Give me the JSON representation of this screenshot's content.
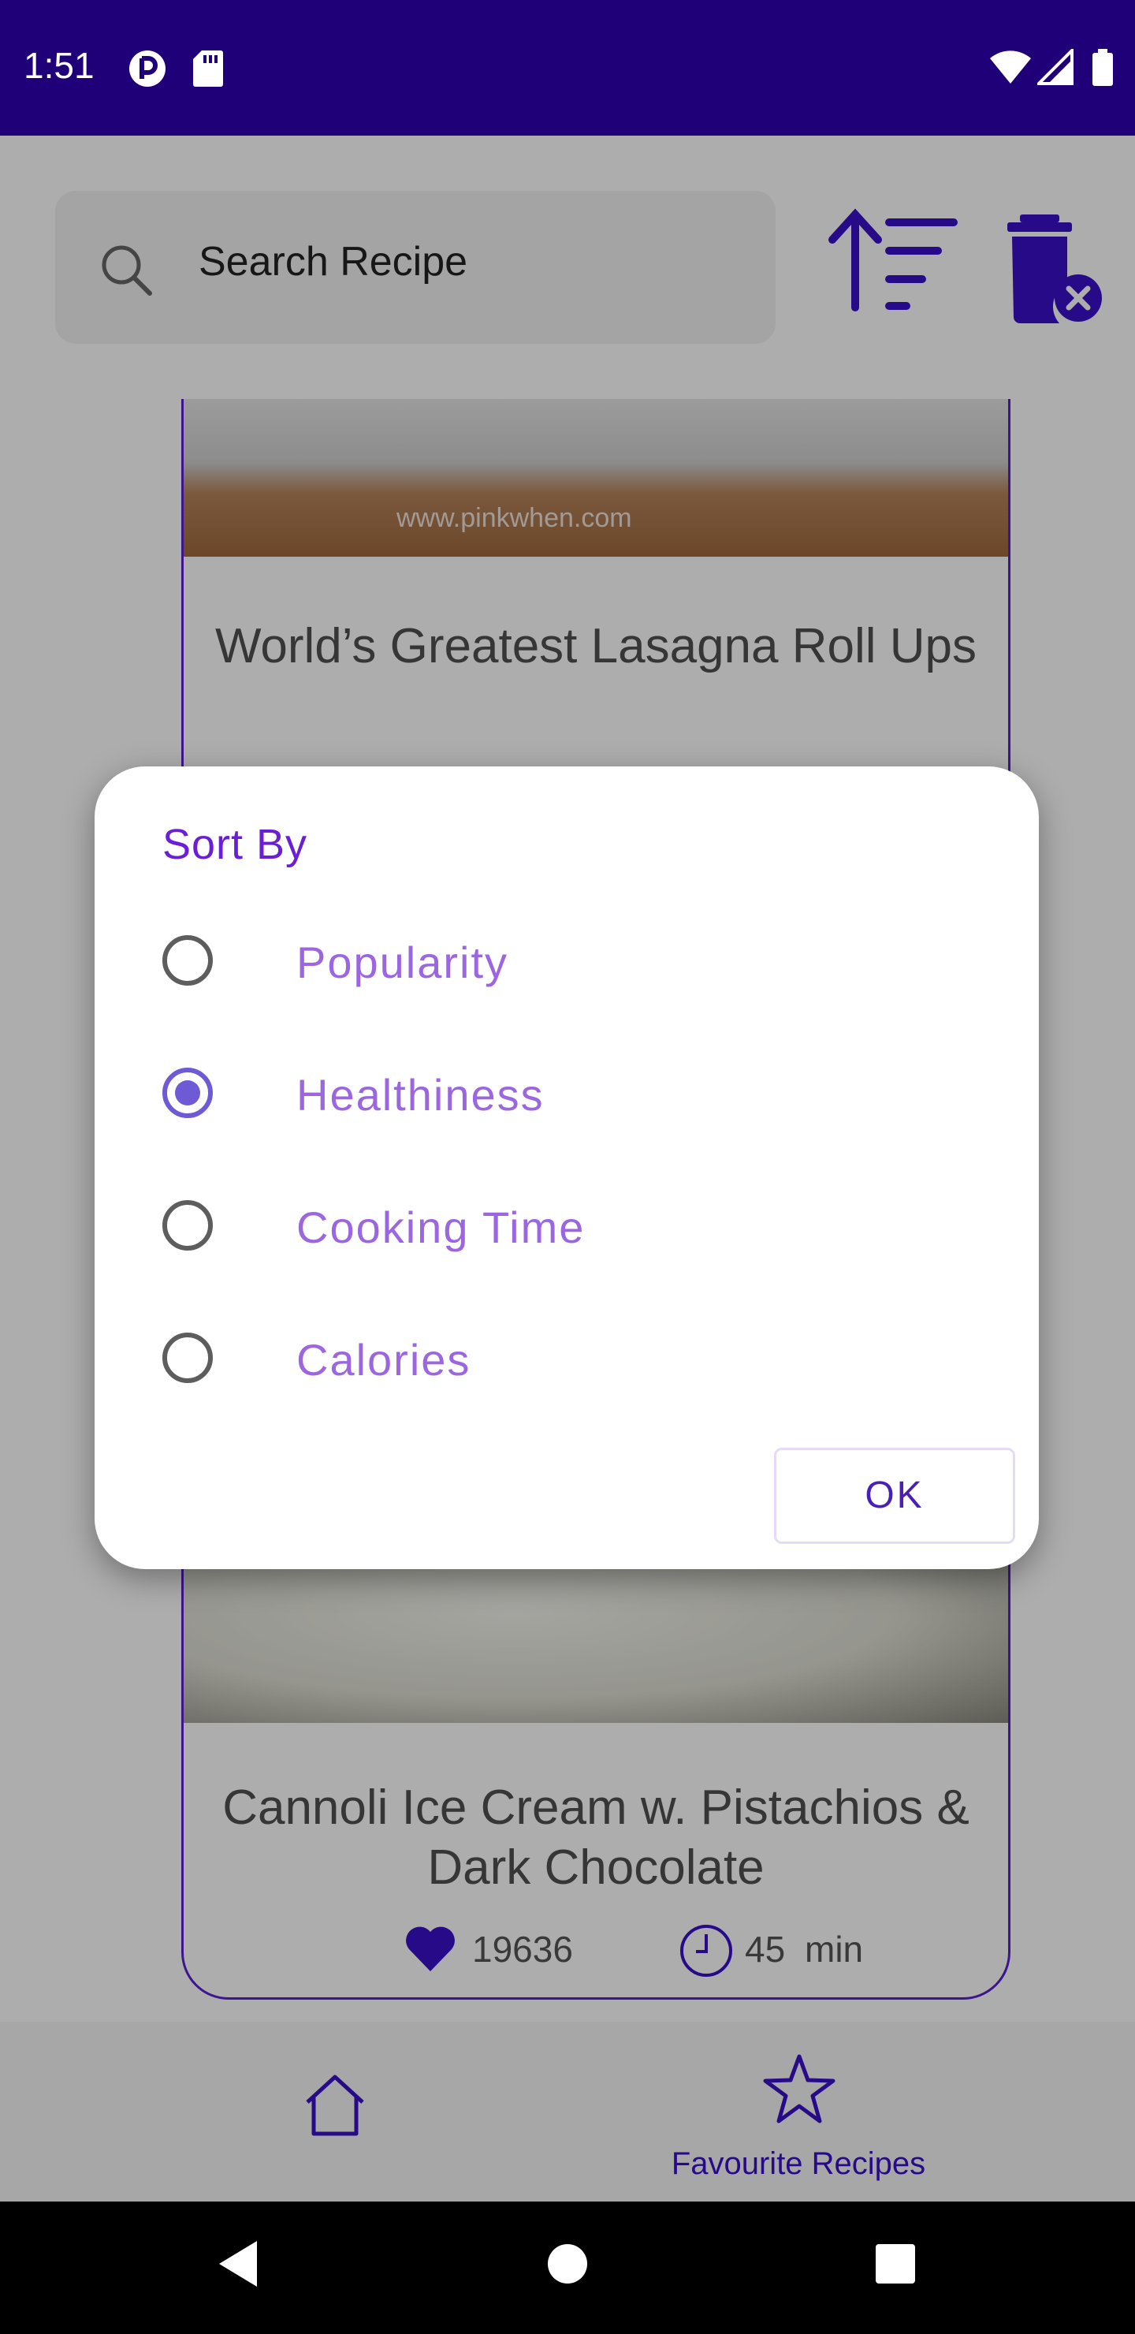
{
  "status_bar": {
    "time": "1:51",
    "icons": [
      "pocket-casts-icon",
      "sd-card-icon",
      "wifi-icon",
      "signal-icon",
      "battery-icon"
    ]
  },
  "search": {
    "placeholder": "Search Recipe"
  },
  "toolbar": {
    "sort_icon": "sort-ascending-icon",
    "delete_icon": "delete-sweep-icon"
  },
  "cards": [
    {
      "title": "World’s Greatest Lasagna Roll Ups",
      "watermark": "www.pinkwhen.com"
    },
    {
      "title": "Cannoli Ice Cream w. Pistachios & Dark Chocolate",
      "likes": "19636",
      "time_value": "45",
      "time_unit": "min"
    }
  ],
  "dialog": {
    "title": "Sort By",
    "options": [
      {
        "label": "Popularity",
        "checked": false
      },
      {
        "label": "Healthiness",
        "checked": true
      },
      {
        "label": "Cooking Time",
        "checked": false
      },
      {
        "label": "Calories",
        "checked": false
      }
    ],
    "ok_label": "OK"
  },
  "bottom_nav": {
    "home_icon": "home-icon",
    "favourites_label": "Favourite Recipes"
  },
  "colors": {
    "status_bar": "#1f0078",
    "accent": "#6a1fd6",
    "option_text": "#9b66e0",
    "radio_checked": "#6f5ad6"
  }
}
